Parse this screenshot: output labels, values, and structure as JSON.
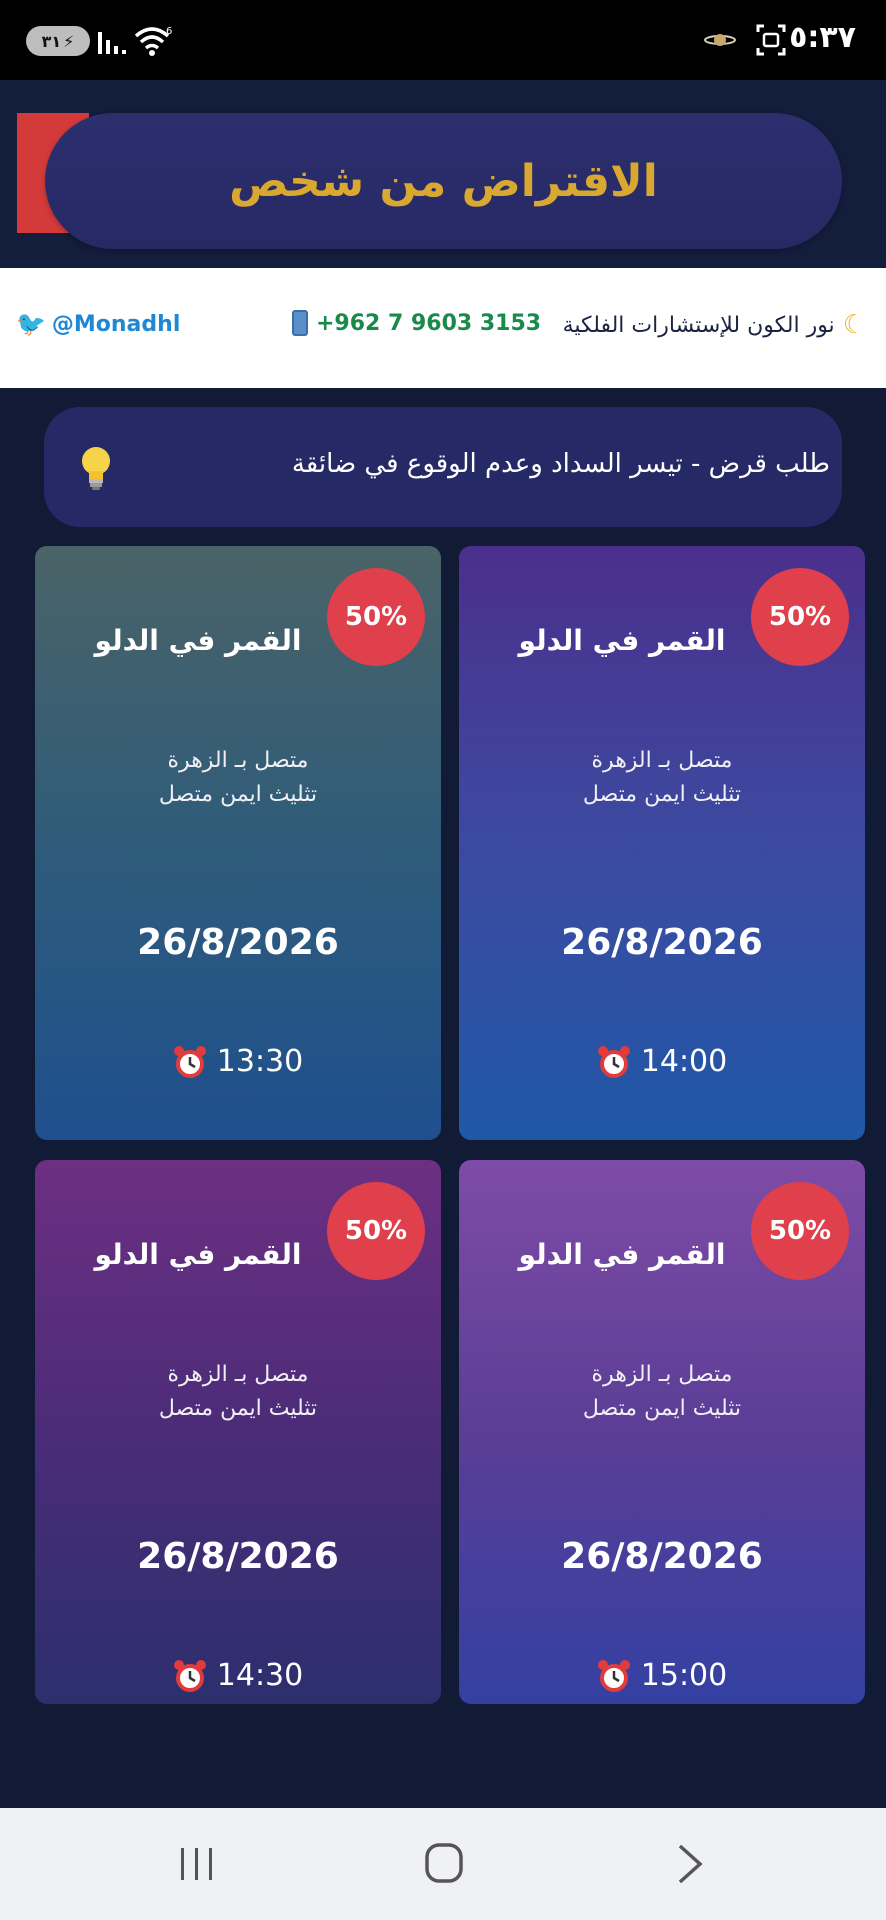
{
  "status_bar": {
    "time": "٥:٣٧",
    "battery": "٣١",
    "wifi_badge": "6"
  },
  "header": {
    "title": "الاقتراض من شخص"
  },
  "contact": {
    "brand": "نور الكون للإستشارات الفلكية",
    "phone": "+962 7 9603 3153",
    "twitter": "@Monadhl"
  },
  "info": {
    "text": "طلب قرض - تيسر السداد وعدم الوقوع في ضائقة"
  },
  "cards": [
    {
      "badge": "50%",
      "title": "القمر في الدلو",
      "line1": "متصل بـ الزهرة",
      "line2": "تثليث ايمن متصل",
      "date": "26/8/2026",
      "time": "14:00"
    },
    {
      "badge": "50%",
      "title": "القمر في الدلو",
      "line1": "متصل بـ الزهرة",
      "line2": "تثليث ايمن متصل",
      "date": "26/8/2026",
      "time": "13:30"
    },
    {
      "badge": "50%",
      "title": "القمر في الدلو",
      "line1": "متصل بـ الزهرة",
      "line2": "تثليث ايمن متصل",
      "date": "26/8/2026",
      "time": "15:00"
    },
    {
      "badge": "50%",
      "title": "القمر في الدلو",
      "line1": "متصل بـ الزهرة",
      "line2": "تثليث ايمن متصل",
      "date": "26/8/2026",
      "time": "14:30"
    }
  ],
  "colors": {
    "title_gold": "#d9a830",
    "badge_red": "#e0404b",
    "phone_green": "#1a8a4a",
    "twitter_blue": "#1e88d6"
  },
  "icons": {
    "moon": "crescent-moon-icon",
    "phone": "mobile-phone-icon",
    "twitter": "bird-icon",
    "bulb": "light-bulb-icon",
    "alarm": "alarm-clock-icon"
  }
}
